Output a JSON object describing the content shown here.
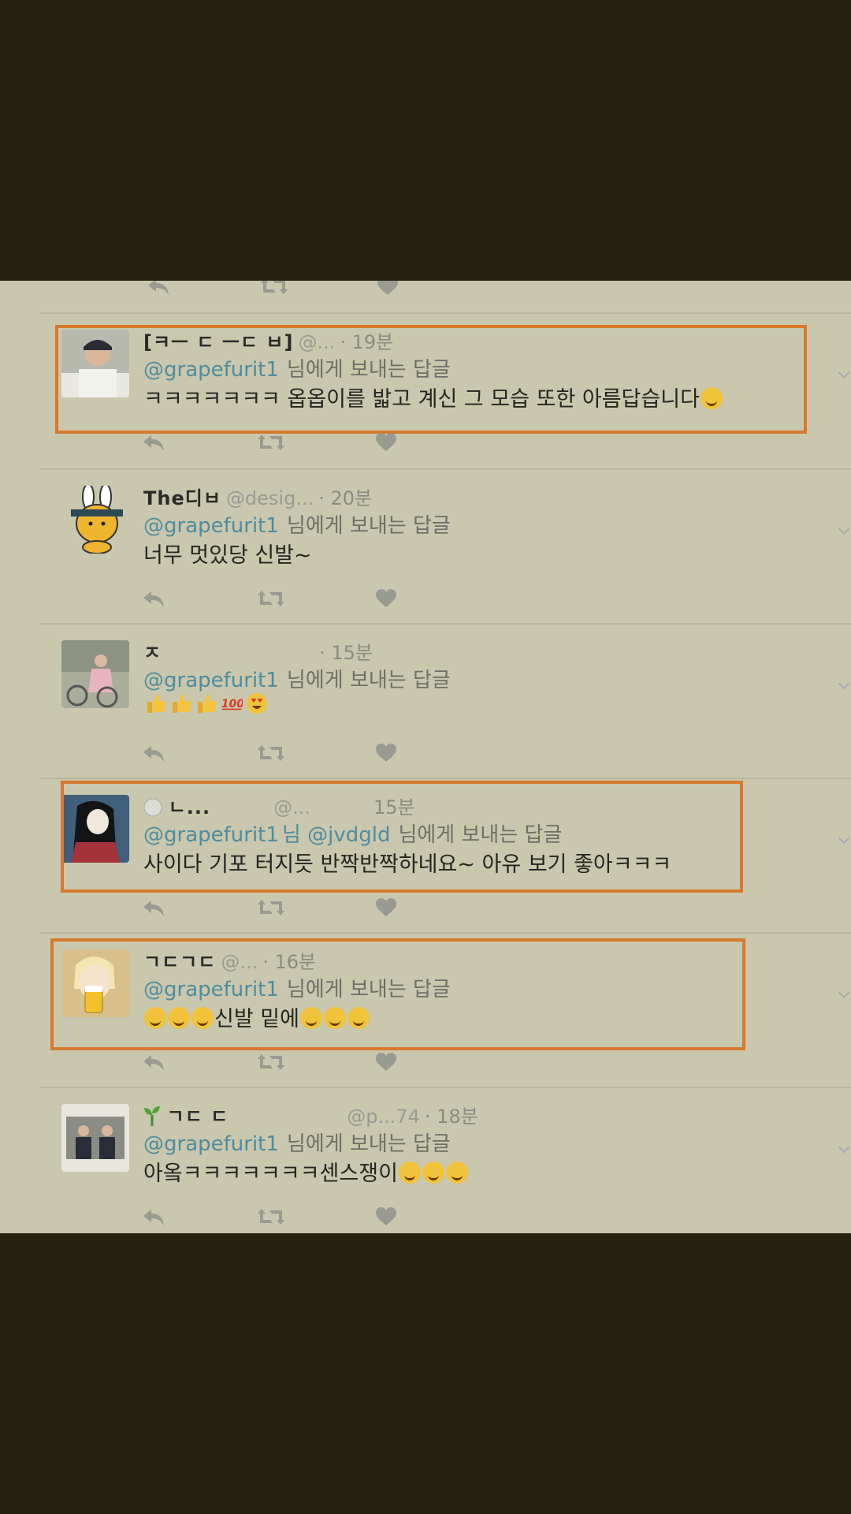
{
  "tweets": [
    {
      "name": "[ㅋㅡ ㄷ ㅡㄷ ㅂ]",
      "handle": "@...",
      "time": "· 19분",
      "mention": "@grapefurit1",
      "reply_text": "님에게 보내는 답글",
      "body": "ㅋㅋㅋㅋㅋㅋㅋ 옵옵이를 밟고 계신 그 모습 또한 아름답습니다",
      "emoji": "wink-emoji",
      "highlighted": true
    },
    {
      "name": "The디ㅂ",
      "handle": "@desig...",
      "time": "· 20분",
      "mention": "@grapefurit1",
      "reply_text": "님에게 보내는 답글",
      "body": "너무 멋있당 신발~",
      "highlighted": false
    },
    {
      "name": "ㅈ",
      "handle": "",
      "time": "· 15분",
      "mention": "@grapefurit1",
      "reply_text": "님에게 보내는 답글",
      "body": "",
      "emoji": "thumbs-100-heart-eyes",
      "highlighted": false
    },
    {
      "name": "ㄴ...",
      "handle": "@...",
      "time": "15분",
      "mention": "@grapefurit1",
      "mention_extra": "님 @jvdgld",
      "reply_text": "님에게 보내는 답글",
      "body": "사이다 기포 터지듯 반짝반짝하네요~ 아유 보기 좋아ㅋㅋㅋ",
      "highlighted": true
    },
    {
      "name": "ㄱㄷㄱㄷ",
      "handle": "@...",
      "time": "· 16분",
      "mention": "@grapefurit1",
      "reply_text": "님에게 보내는 답글",
      "body": "신발 밑에",
      "highlighted": true
    },
    {
      "name": "ㄱㄷ ㄷ",
      "handle": "@p...74",
      "time": "· 18분",
      "mention": "@grapefurit1",
      "reply_text": "님에게 보내는 답글",
      "body": "아옼ㅋㅋㅋㅋㅋㅋㅋ센스쟁이",
      "highlighted": false
    }
  ],
  "colors": {
    "highlight": "#d67a2d",
    "panel": "#c9c7ad",
    "background": "#26200f",
    "mention": "#4f8d9d"
  }
}
